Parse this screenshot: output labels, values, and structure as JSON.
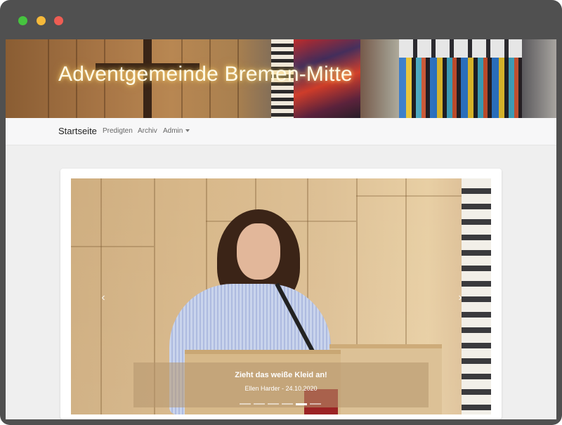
{
  "window": {
    "controls": [
      {
        "name": "green",
        "color": "#46c43f"
      },
      {
        "name": "yellow",
        "color": "#f5b93a"
      },
      {
        "name": "red",
        "color": "#ee5d53"
      }
    ]
  },
  "header": {
    "title": "Adventgemeinde Bremen-Mitte"
  },
  "nav": {
    "brand": "Startseite",
    "items": [
      {
        "label": "Predigten"
      },
      {
        "label": "Archiv"
      },
      {
        "label": "Admin"
      }
    ]
  },
  "carousel": {
    "prev_icon": "chevron-left-icon",
    "next_icon": "chevron-right-icon",
    "prev_glyph": "‹",
    "next_glyph": "›",
    "caption": {
      "title": "Zieht das weiße Kleid an!",
      "subtitle": "Ellen Harder - 24.10.2020"
    },
    "slide_count": 6,
    "active_slide": 4
  }
}
